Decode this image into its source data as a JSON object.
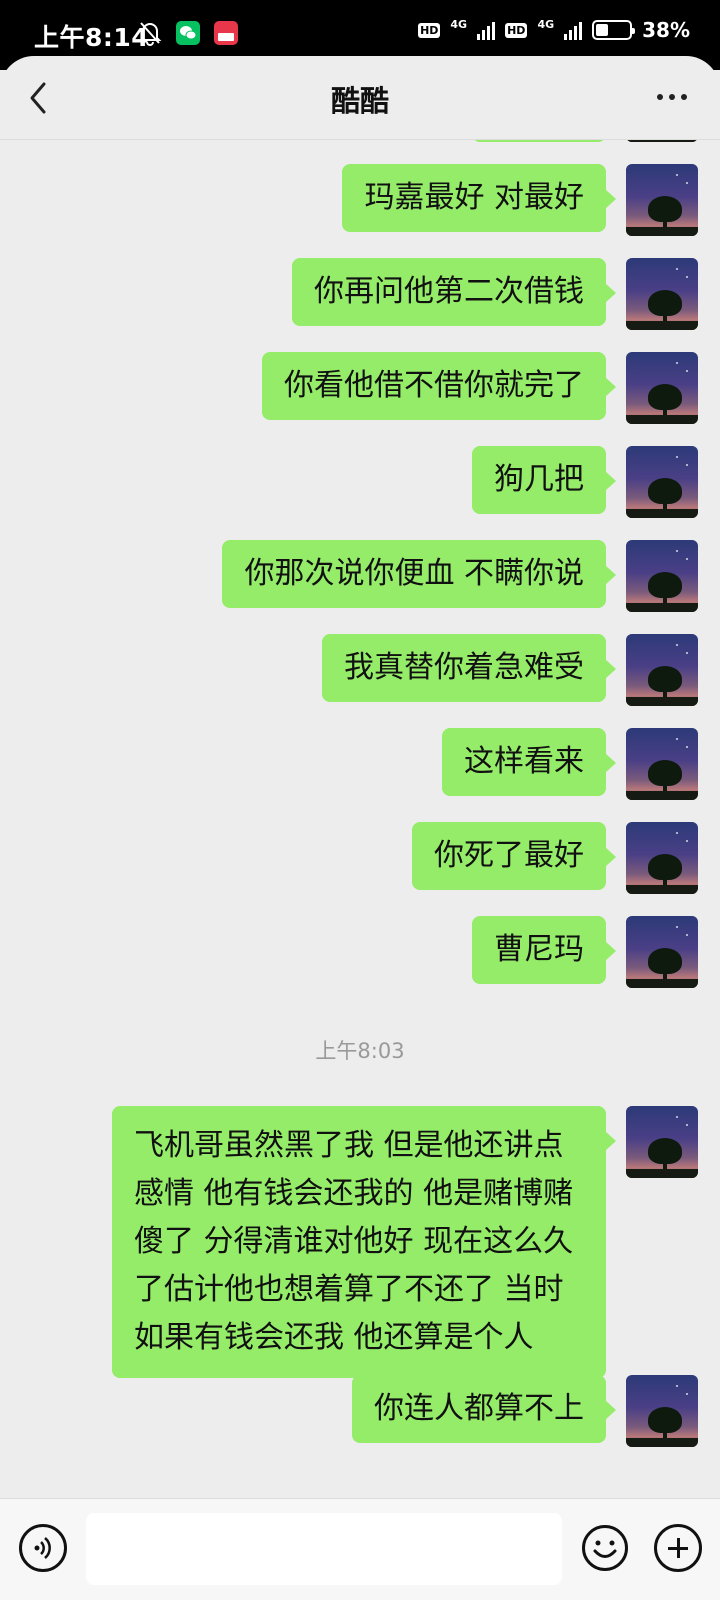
{
  "status_bar": {
    "time": "上午8:14",
    "network_1": "4G",
    "network_2": "4G",
    "hd_1": "HD",
    "hd_2": "HD",
    "battery": "38%",
    "battery_level_percent": 38,
    "icons": [
      "mute-bell-icon",
      "wechat-icon",
      "app-badge-icon"
    ]
  },
  "header": {
    "title": "酷酷",
    "back_icon": "chevron-left-icon",
    "more_icon": "more-dots-icon"
  },
  "messages": [
    {
      "text": "",
      "from": "me"
    },
    {
      "text": "玛嘉最好 对最好",
      "from": "me"
    },
    {
      "text": "你再问他第二次借钱",
      "from": "me"
    },
    {
      "text": "你看他借不借你就完了",
      "from": "me"
    },
    {
      "text": "狗几把",
      "from": "me"
    },
    {
      "text": "你那次说你便血 不瞒你说",
      "from": "me"
    },
    {
      "text": "我真替你着急难受",
      "from": "me"
    },
    {
      "text": "这样看来",
      "from": "me"
    },
    {
      "text": "你死了最好",
      "from": "me"
    },
    {
      "text": "曹尼玛",
      "from": "me"
    },
    {
      "text": "飞机哥虽然黑了我 但是他还讲点感情 他有钱会还我的 他是赌博赌傻了 分得清谁对他好 现在这么久了估计他也想着算了不还了 当时如果有钱会还我 他还算是个人",
      "from": "me"
    },
    {
      "text": "你连人都算不上",
      "from": "me"
    }
  ],
  "timestamp": "上午8:03",
  "input_bar": {
    "voice_icon": "voice-icon",
    "emoji_icon": "emoji-icon",
    "plus_icon": "plus-icon",
    "placeholder": ""
  },
  "colors": {
    "bubble_me": "#95ec69",
    "background": "#ededed",
    "timestamp_text": "#999999"
  }
}
